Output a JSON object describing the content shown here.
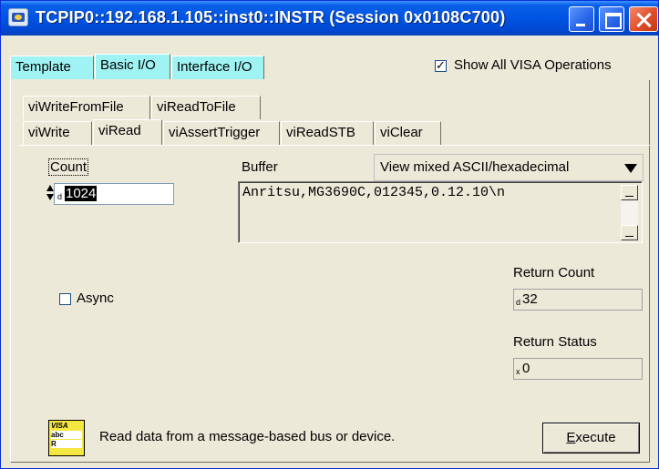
{
  "window": {
    "title": "TCPIP0::192.168.1.105::inst0::INSTR (Session 0x0108C700)"
  },
  "outer_tabs": [
    {
      "label": "Template"
    },
    {
      "label": "Basic I/O",
      "active": true
    },
    {
      "label": "Interface I/O"
    }
  ],
  "show_all_visa": {
    "label": "Show All VISA Operations",
    "checked": true
  },
  "inner_tabs_row1": [
    {
      "label": "viWriteFromFile"
    },
    {
      "label": "viReadToFile"
    }
  ],
  "inner_tabs_row2": [
    {
      "label": "viWrite"
    },
    {
      "label": "viRead",
      "active": true
    },
    {
      "label": "viAssertTrigger"
    },
    {
      "label": "viReadSTB"
    },
    {
      "label": "viClear"
    }
  ],
  "count": {
    "label": "Count",
    "radix": "d",
    "value": "1024"
  },
  "buffer": {
    "label": "Buffer",
    "display_mode": "View mixed ASCII/hexadecimal",
    "content": "Anritsu,MG3690C,012345,0.12.10\\n"
  },
  "return_count": {
    "label": "Return Count",
    "radix": "d",
    "value": "32"
  },
  "async": {
    "label": "Async",
    "checked": false
  },
  "return_status": {
    "label": "Return Status",
    "radix": "x",
    "value": "0"
  },
  "visa_icon": {
    "line1": "VISA",
    "line2": "abc",
    "line3": "R"
  },
  "description": "Read data from a message-based bus or device.",
  "execute_button": {
    "label_underlined": "E",
    "label_rest": "xecute"
  },
  "colors": {
    "titlebar": "#0054e3",
    "window_bg": "#ece9d8",
    "tab_highlight": "#9ff3f3",
    "icon_bg": "#f5e642"
  }
}
